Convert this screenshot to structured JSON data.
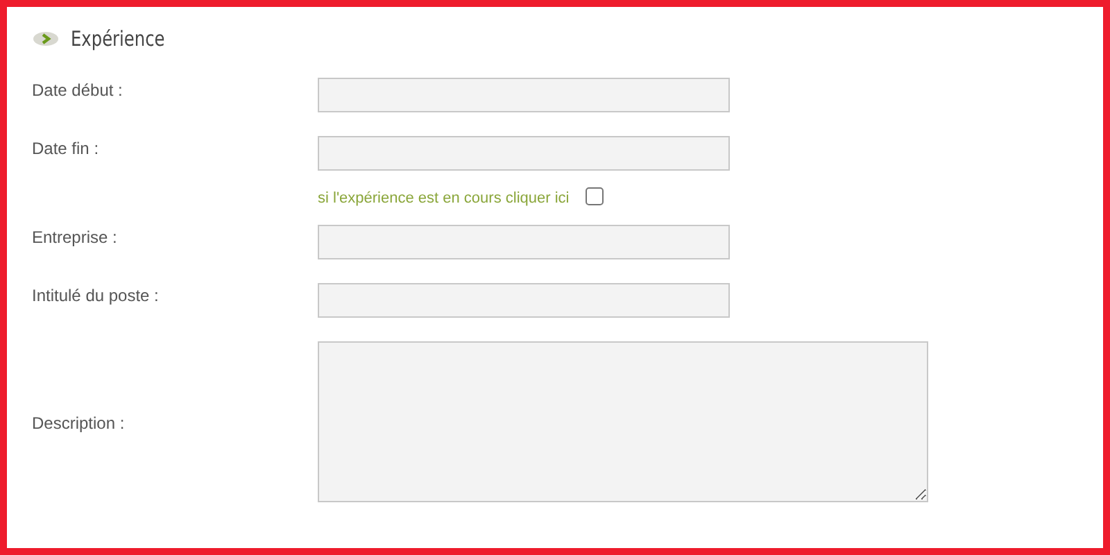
{
  "section": {
    "title": "Expérience"
  },
  "fields": [
    {
      "label": "Date début :",
      "kind": "text"
    },
    {
      "label": "Date fin :",
      "kind": "text",
      "note": {
        "text": "si l'expérience est en cours cliquer ici",
        "checked": false
      }
    },
    {
      "label": "Entreprise :",
      "kind": "text"
    },
    {
      "label": "Intitulé du poste :",
      "kind": "text"
    },
    {
      "label": "Description :",
      "kind": "textarea"
    }
  ]
}
